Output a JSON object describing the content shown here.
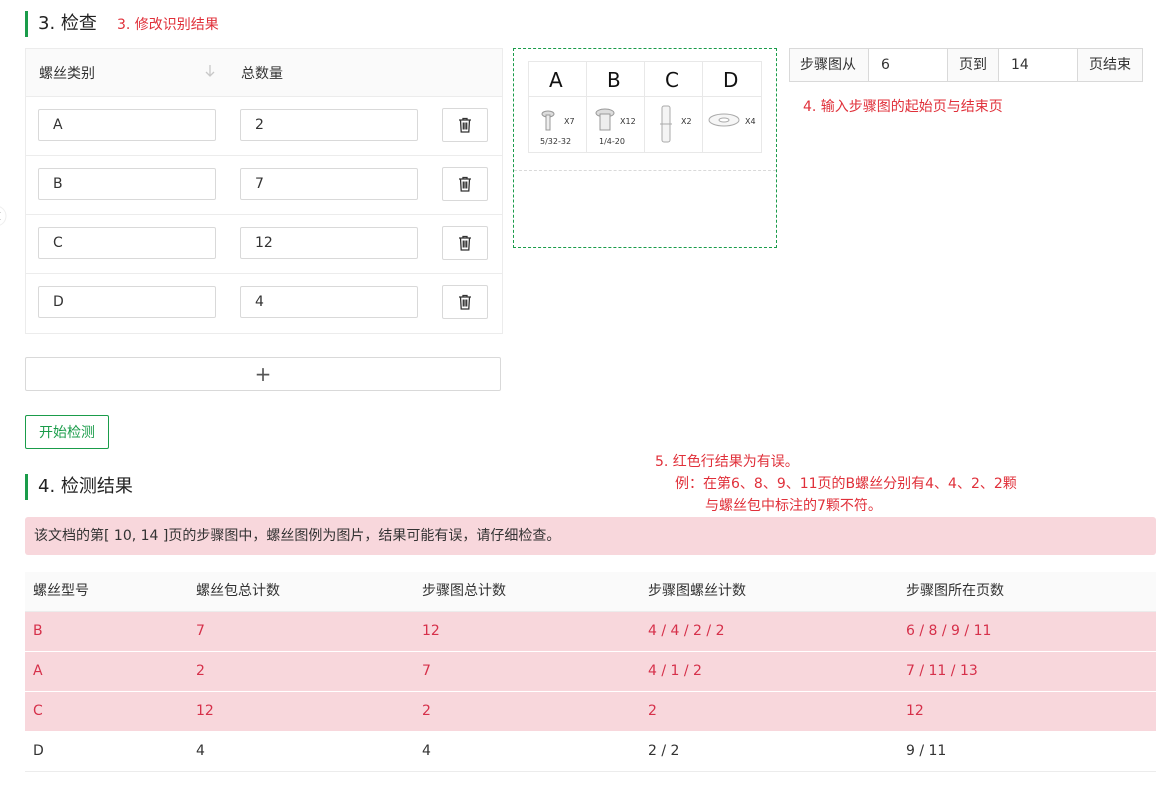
{
  "section3": {
    "title": "3. 检查",
    "annotation": "3. 修改识别结果"
  },
  "screw_table": {
    "col_type": "螺丝类别",
    "col_total": "总数量",
    "rows": [
      {
        "type": "A",
        "total": "2"
      },
      {
        "type": "B",
        "total": "7"
      },
      {
        "type": "C",
        "total": "12"
      },
      {
        "type": "D",
        "total": "4"
      }
    ],
    "add_label": "+"
  },
  "illustration": {
    "letters": [
      "A",
      "B",
      "C",
      "D"
    ],
    "qty": [
      "X7",
      "X12",
      "X2",
      "X4"
    ],
    "sizes": [
      "5/32-32",
      "1/4-20",
      "",
      ""
    ]
  },
  "page_range": {
    "from_label": "步骤图从",
    "from_value": "6",
    "to_label": "页到",
    "to_value": "14",
    "end_label": "页结束"
  },
  "annotation4": "4. 输入步骤图的起始页与结束页",
  "start_button": "开始检测",
  "annotation5": {
    "line1": "5. 红色行结果为有误。",
    "line2": "例：在第6、8、9、11页的B螺丝分别有4、4、2、2颗",
    "line3": "与螺丝包中标注的7颗不符。"
  },
  "section4": {
    "title": "4. 检测结果"
  },
  "alert_text": "该文档的第[ 10, 14 ]页的步骤图中，螺丝图例为图片，结果可能有误，请仔细检查。",
  "results": {
    "headers": [
      "螺丝型号",
      "螺丝包总计数",
      "步骤图总计数",
      "步骤图螺丝计数",
      "步骤图所在页数"
    ],
    "rows": [
      {
        "status": "error",
        "cells": [
          "B",
          "7",
          "12",
          "4 / 4 / 2 / 2",
          "6 / 8 / 9 / 11"
        ]
      },
      {
        "status": "error",
        "cells": [
          "A",
          "2",
          "7",
          "4 / 1 / 2",
          "7 / 11 / 13"
        ]
      },
      {
        "status": "error",
        "cells": [
          "C",
          "12",
          "2",
          "2",
          "12"
        ]
      },
      {
        "status": "ok",
        "cells": [
          "D",
          "4",
          "4",
          "2 / 2",
          "9 / 11"
        ]
      }
    ]
  },
  "colors": {
    "accent": "#1a9c4a",
    "error_bg": "#f8d7dc",
    "error_text": "#d6304a",
    "annotation": "#e0303a"
  }
}
